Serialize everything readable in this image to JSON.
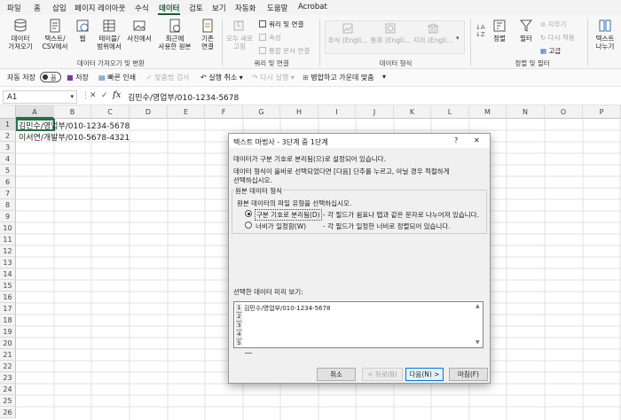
{
  "menu": {
    "tabs": [
      "파일",
      "홈",
      "삽입",
      "페이지 레이아웃",
      "수식",
      "데이터",
      "검토",
      "보기",
      "자동화",
      "도움말",
      "Acrobat"
    ],
    "active": "데이터"
  },
  "ribbon": {
    "get_data": "데이터\n가져오기",
    "text_csv": "텍스트/\nCSV에서",
    "web": "웹",
    "table_range": "테이블/\n범위에서",
    "photo": "사진에서",
    "recent_sources": "최근에\n사용한 원본",
    "existing_conn": "기존\n연결",
    "group_get_transform": "데이터 가져오기 및 변환",
    "refresh_all": "모두 새로\n고침",
    "queries_connections": "쿼리 및 연결",
    "properties": "속성",
    "edit_links": "통합 문서 연결",
    "group_queries": "쿼리 및 연결",
    "stocks": "주식 (Engli...",
    "currencies": "통화 (Engli...",
    "geography": "지리 (Engli...",
    "group_datatypes": "데이터 형식",
    "sort": "정렬",
    "filter": "필터",
    "clear": "지우기",
    "reapply": "다시 적용",
    "advanced": "고급",
    "group_sort_filter": "정렬 및 필터",
    "text_to_columns": "텍스트\n나누기"
  },
  "qat": {
    "autosave_label": "자동 저장",
    "toggle_state": "끔",
    "save": "저장",
    "quick_print": "빠른 인쇄",
    "spell_check": "맞춤법 검사",
    "undo": "실행 취소",
    "redo": "다시 실행",
    "merge_center": "병합하고 가운데 맞춤"
  },
  "formula_bar": {
    "name_box": "A1",
    "fx": "fx",
    "content": "김민수/영업부/010-1234-5678"
  },
  "sheet": {
    "columns": [
      "A",
      "B",
      "C",
      "D",
      "E",
      "F",
      "G",
      "H",
      "I",
      "J",
      "K",
      "L",
      "M",
      "N",
      "O",
      "P"
    ],
    "rows": [
      "1",
      "2",
      "3",
      "4",
      "5",
      "6",
      "7",
      "8",
      "9",
      "10",
      "11",
      "12",
      "13",
      "14",
      "15",
      "16",
      "17",
      "18",
      "19",
      "20",
      "21",
      "22",
      "23",
      "24",
      "25",
      "26"
    ],
    "cells": {
      "A1": "김민수/영업부/010-1234-5678",
      "A2": "이서연/개발부/010-5678-4321"
    }
  },
  "dialog": {
    "title": "텍스트 마법사 - 3단계 중 1단계",
    "help": "?",
    "close": "✕",
    "line1": "데이터가 구분 기호로 분리됨(으)로 설정되어 있습니다.",
    "line2": "데이터 형식이 올바로 선택되었다면 [다음] 단추를 누르고, 아닐 경우 적절하게",
    "line3": "선택하십시오.",
    "section_title": "원본 데이터 형식",
    "section_prompt": "원본 데이터의 파일 유형을 선택하십시오.",
    "option1_label": "구분 기호로 분리됨(D)",
    "option1_desc": "- 각 필드가 쉼표나 탭과 같은 문자로 나누어져 있습니다.",
    "option2_label": "너비가 일정함(W)",
    "option2_desc": "- 각 필드가 일정한 너비로 정렬되어 있습니다.",
    "preview_label": "선택한 데이터 미리 보기:",
    "preview_rows": [
      "1",
      "2",
      "3",
      "4",
      "5"
    ],
    "preview_line1": "김민수/영업부/010-1234-5678",
    "btn_cancel": "취소",
    "btn_back": "< 뒤로(B)",
    "btn_next": "다음(N) >",
    "btn_finish": "마침(F)"
  }
}
